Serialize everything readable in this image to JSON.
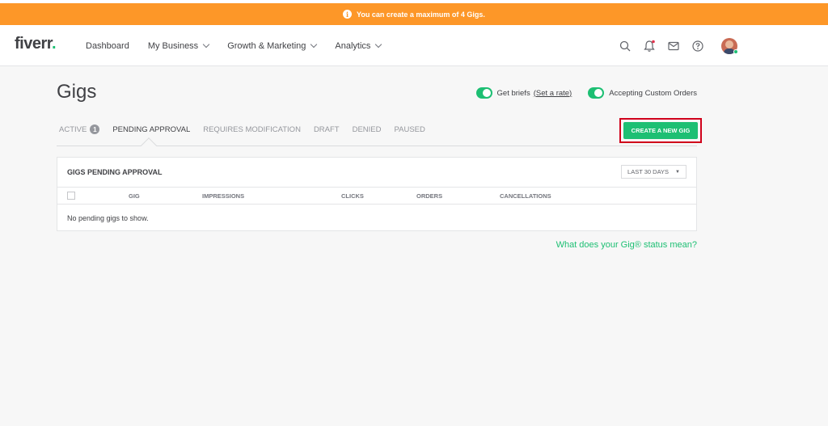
{
  "banner": {
    "text": "You can create a maximum of 4 Gigs.",
    "icon": "info-icon"
  },
  "header": {
    "logo_text": "fiverr",
    "logo_dot": ".",
    "nav": [
      {
        "label": "Dashboard",
        "has_dropdown": false
      },
      {
        "label": "My Business",
        "has_dropdown": true
      },
      {
        "label": "Growth & Marketing",
        "has_dropdown": true
      },
      {
        "label": "Analytics",
        "has_dropdown": true
      }
    ],
    "icons": [
      "search-icon",
      "bell-icon",
      "mail-icon",
      "help-icon"
    ]
  },
  "page": {
    "title": "Gigs",
    "toggles": {
      "briefs_label": "Get briefs",
      "briefs_link": "(Set a rate)",
      "custom_orders_label": "Accepting Custom Orders"
    },
    "tabs": [
      {
        "label": "ACTIVE",
        "count": "1"
      },
      {
        "label": "PENDING APPROVAL",
        "active": true
      },
      {
        "label": "REQUIRES MODIFICATION"
      },
      {
        "label": "DRAFT"
      },
      {
        "label": "DENIED"
      },
      {
        "label": "PAUSED"
      }
    ],
    "create_button": "CREATE A NEW GIG"
  },
  "table": {
    "title": "GIGS PENDING APPROVAL",
    "period": "LAST 30 DAYS",
    "columns": [
      "GIG",
      "IMPRESSIONS",
      "CLICKS",
      "ORDERS",
      "CANCELLATIONS"
    ],
    "empty_message": "No pending gigs to show."
  },
  "footer_link": "What does your Gig® status mean?",
  "colors": {
    "accent": "#1dbf73",
    "banner": "#fd9728",
    "highlight": "#d0021b"
  }
}
